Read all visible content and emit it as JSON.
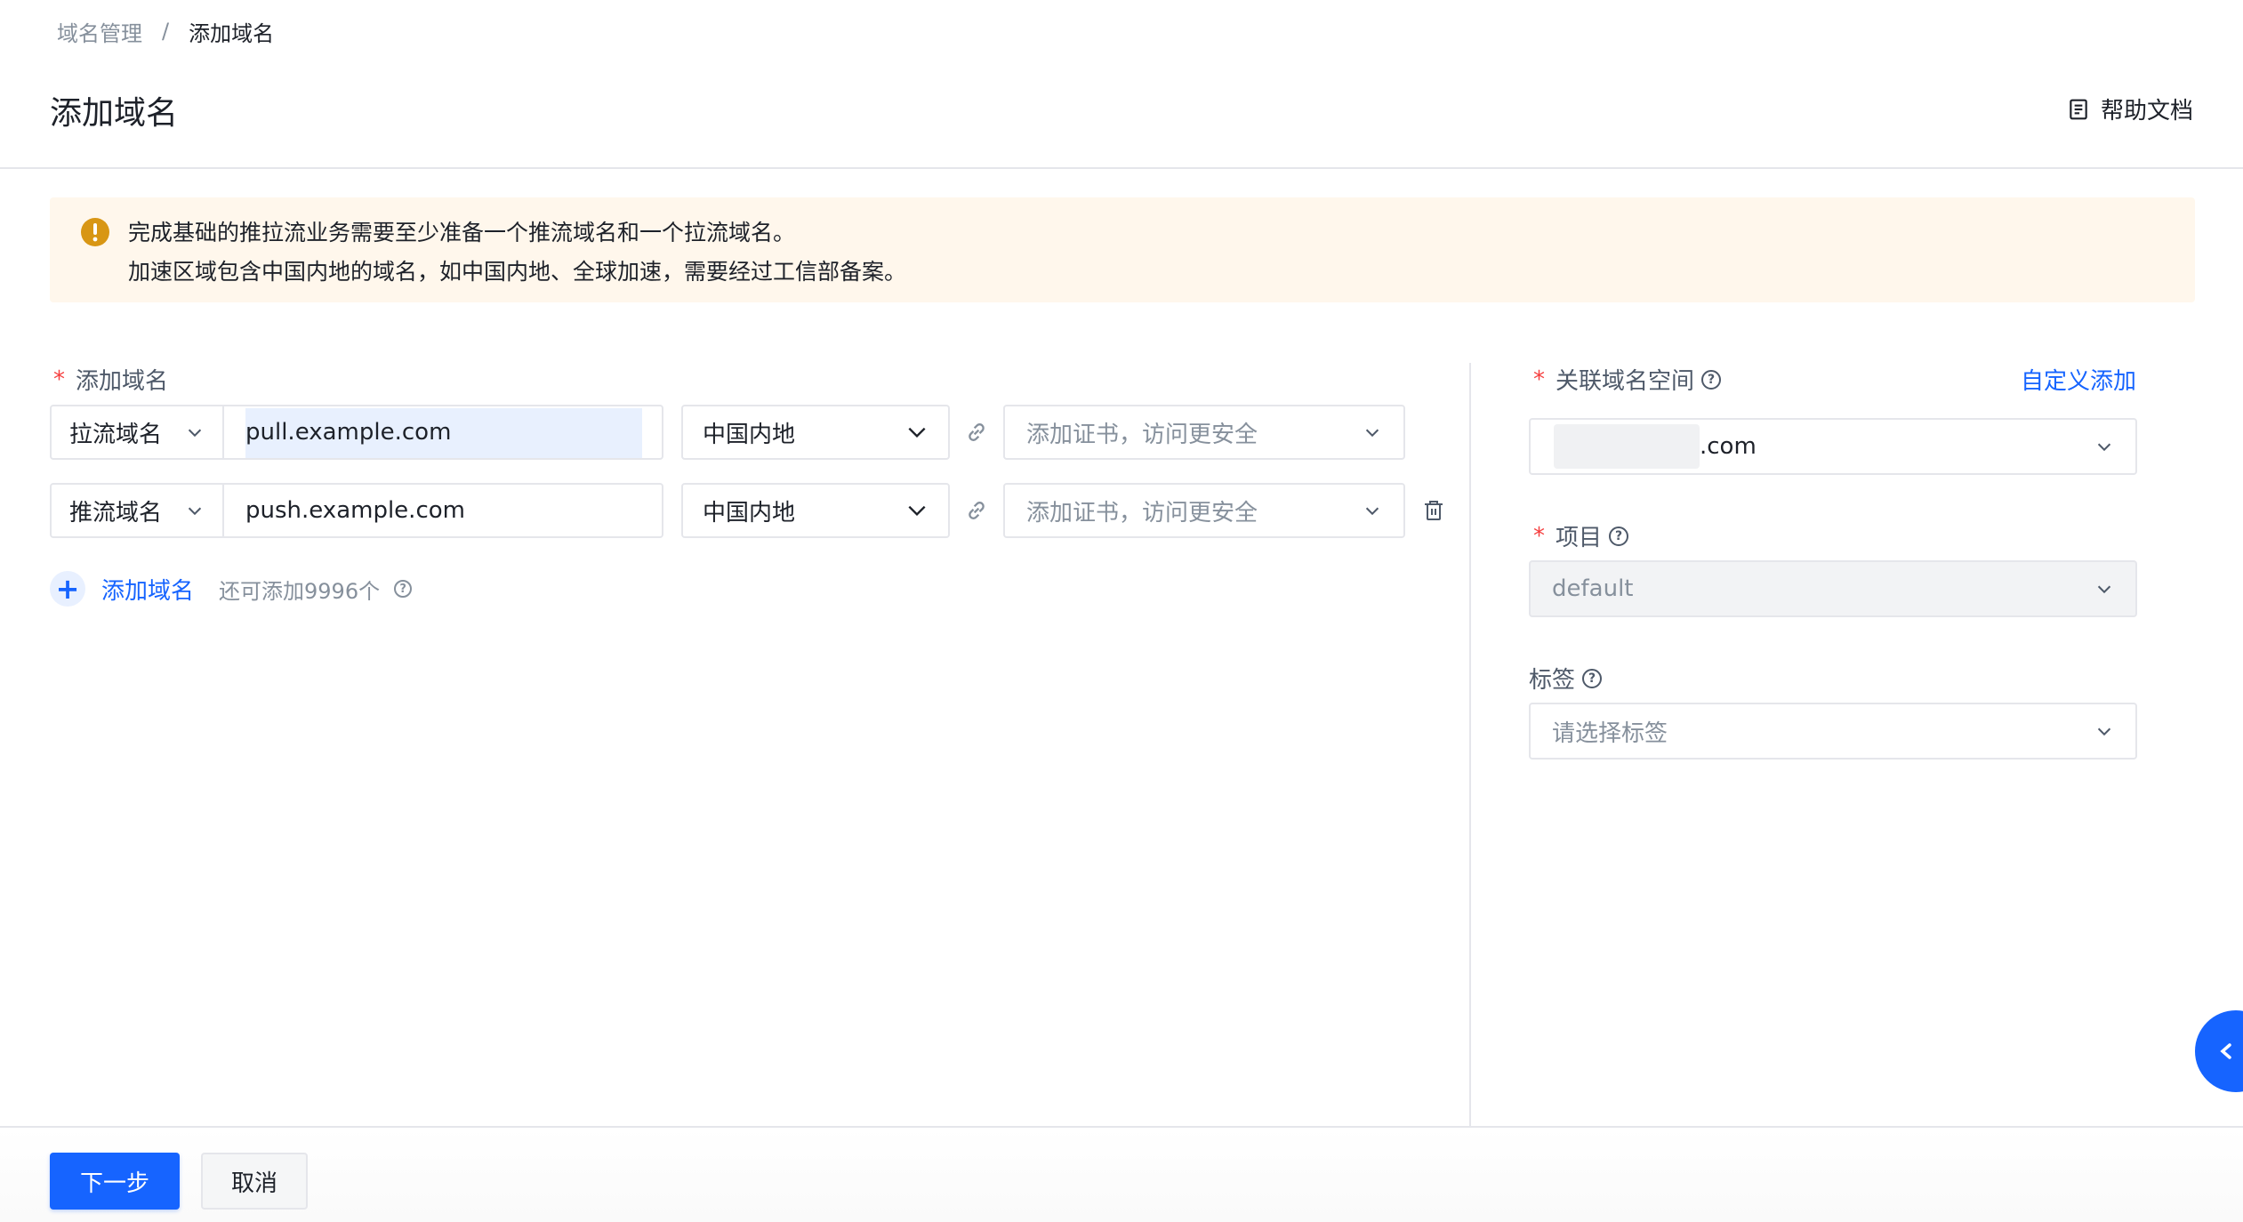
{
  "breadcrumb": {
    "parent": "域名管理",
    "separator": "/",
    "current": "添加域名"
  },
  "page_title": "添加域名",
  "help_doc_label": "帮助文档",
  "alert": {
    "line1": "完成基础的推拉流业务需要至少准备一个推流域名和一个拉流域名。",
    "line2": "加速区域包含中国内地的域名，如中国内地、全球加速，需要经过工信部备案。",
    "color": "#fff7ec"
  },
  "form": {
    "add_domain_label": "添加域名",
    "required_mark": "*",
    "rows": [
      {
        "type": "拉流域名",
        "domain": "pull.example.com",
        "region": "中国内地",
        "cert_placeholder": "添加证书，访问更安全"
      },
      {
        "type": "推流域名",
        "domain": "push.example.com",
        "region": "中国内地",
        "cert_placeholder": "添加证书，访问更安全"
      }
    ],
    "add_button": "添加域名",
    "remaining": "还可添加9996个"
  },
  "side": {
    "namespace_label": "关联域名空间",
    "custom_add": "自定义添加",
    "namespace_value_suffix": ".com",
    "project_label": "项目",
    "project_value": "default",
    "tag_label": "标签",
    "tag_placeholder": "请选择标签"
  },
  "footer": {
    "next": "下一步",
    "cancel": "取消"
  },
  "colors": {
    "primary": "#1664ff",
    "required": "#f53f3f",
    "warning": "#d89614"
  }
}
